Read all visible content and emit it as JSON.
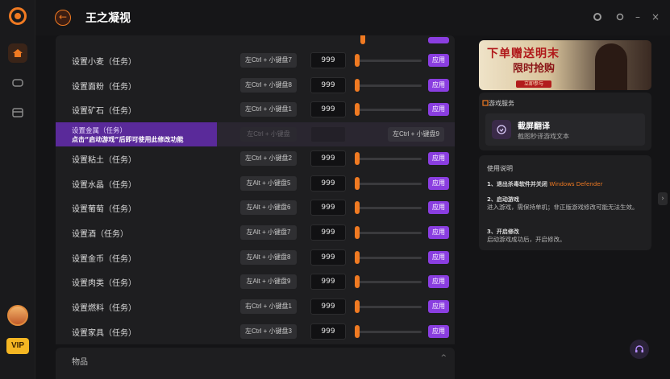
{
  "app": {
    "title": "王之凝视"
  },
  "window_controls": [
    "circle-icon",
    "settings-icon",
    "minimize-icon",
    "close-icon"
  ],
  "rows": [
    {
      "label": "设置小麦（任务）",
      "hotkey": "左Ctrl + 小键盘7",
      "value": "999",
      "apply": "应用"
    },
    {
      "label": "设置面粉（任务）",
      "hotkey": "左Ctrl + 小键盘8",
      "value": "999",
      "apply": "应用"
    },
    {
      "label": "设置矿石（任务）",
      "hotkey": "左Ctrl + 小键盘1",
      "value": "999",
      "apply": "应用"
    },
    {
      "label": "设置粘土（任务）",
      "hotkey": "左Ctrl + 小键盘2",
      "value": "999",
      "apply": "应用"
    },
    {
      "label": "设置水晶（任务）",
      "hotkey": "左Alt + 小键盘5",
      "value": "999",
      "apply": "应用"
    },
    {
      "label": "设置葡萄（任务）",
      "hotkey": "左Alt + 小键盘6",
      "value": "999",
      "apply": "应用"
    },
    {
      "label": "设置酒（任务）",
      "hotkey": "左Alt + 小键盘7",
      "value": "999",
      "apply": "应用"
    },
    {
      "label": "设置金币（任务）",
      "hotkey": "左Alt + 小键盘8",
      "value": "999",
      "apply": "应用"
    },
    {
      "label": "设置肉类（任务）",
      "hotkey": "左Alt + 小键盘9",
      "value": "999",
      "apply": "应用"
    },
    {
      "label": "设置燃料（任务）",
      "hotkey": "右Ctrl + 小键盘1",
      "value": "999",
      "apply": "应用"
    },
    {
      "label": "设置家具（任务）",
      "hotkey": "左Ctrl + 小键盘3",
      "value": "999",
      "apply": "应用"
    }
  ],
  "highlight_row": {
    "label": "设置金属（任务）",
    "notice": "点击“启动游戏”后即可使用此修改功能",
    "hotkey_faded": "左Ctrl + 小键盘",
    "hotkey": "左Ctrl + 小键盘9"
  },
  "collapsed_section": {
    "label": "物品"
  },
  "banner": {
    "title": "下单赠送明末",
    "subtitle": "限时抢购",
    "button": "立即参与"
  },
  "service": {
    "heading": "游戏服务",
    "card_title": "截屏翻译",
    "card_subtitle": "截图秒译游戏文本"
  },
  "usage": {
    "heading": "使用说明",
    "step1_title": "1、退出杀毒软件并关闭",
    "step1_highlight": "Windows Defender",
    "step2_title": "2、启动游戏",
    "step2_desc": "进入游戏，需保持单机；非正版游戏修改可能无法生效。",
    "step3_title": "3、开启修改",
    "step3_desc": "启动游戏成功后，开启修改。"
  },
  "vip_label": "VIP",
  "colors": {
    "accent": "#f07a22",
    "apply": "#8a3ee0",
    "highlight": "#5a2a9a"
  }
}
